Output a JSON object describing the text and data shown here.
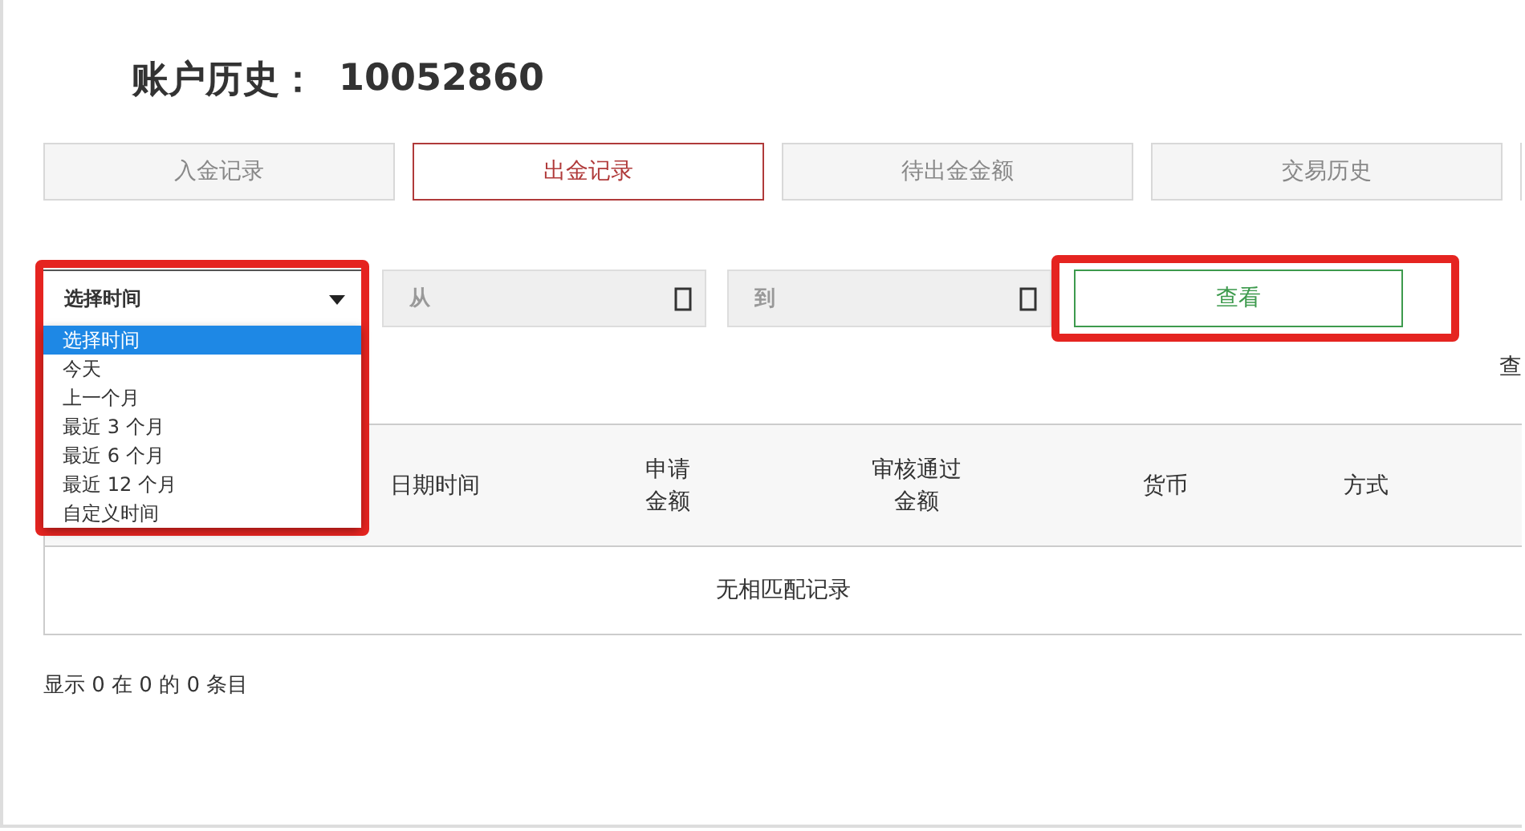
{
  "title": {
    "label": "账户历史：",
    "account": "10052860"
  },
  "tabs": [
    {
      "label": "入金记录",
      "selected": false
    },
    {
      "label": "出金记录",
      "selected": true
    },
    {
      "label": "待出金金额",
      "selected": false
    },
    {
      "label": "交易历史",
      "selected": false
    }
  ],
  "filter": {
    "select": {
      "value": "选择时间",
      "expanded": true,
      "highlighted": true,
      "options": [
        {
          "label": "选择时间",
          "selected": true
        },
        {
          "label": "今天",
          "selected": false
        },
        {
          "label": "上一个月",
          "selected": false
        },
        {
          "label": "最近 3 个月",
          "selected": false
        },
        {
          "label": "最近 6 个月",
          "selected": false
        },
        {
          "label": "最近 12 个月",
          "selected": false
        },
        {
          "label": "自定义时间",
          "selected": false
        }
      ]
    },
    "from": {
      "placeholder": "从"
    },
    "to": {
      "placeholder": "到"
    },
    "view_button": {
      "label": "查看",
      "highlighted": true
    }
  },
  "side_text": "查",
  "table": {
    "columns": [
      "",
      "日期时间",
      "申请金额",
      "审核通过金额",
      "货币",
      "方式"
    ],
    "empty_message": "无相匹配记录"
  },
  "footer": "显示 0 在 0 的 0 条目"
}
